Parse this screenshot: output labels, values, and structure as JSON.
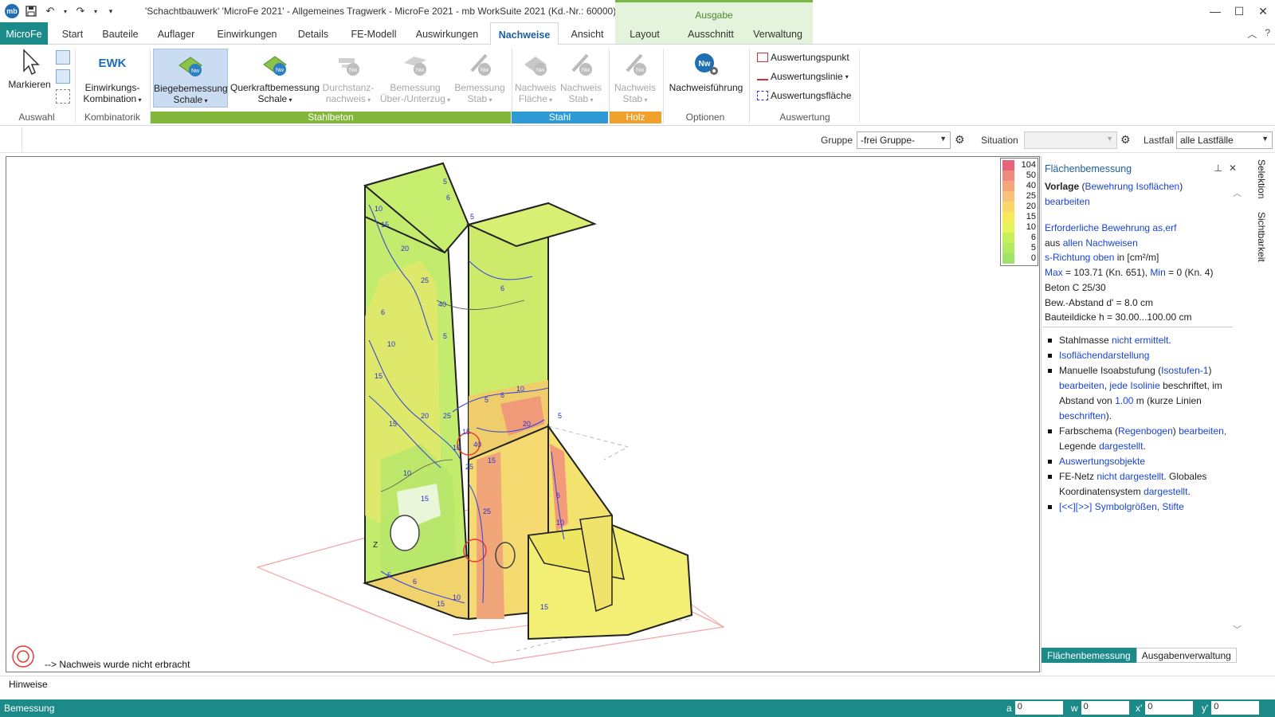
{
  "titlebar": {
    "title": "'Schachtbauwerk' 'MicroFe 2021' -  Allgemeines Tragwerk - MicroFe 2021 -  mb WorkSuite 2021 (Kd.-Nr.: 60000)",
    "context_group": "Ausgabe",
    "logo_text": "mb"
  },
  "tabs": {
    "file": "MicroFe",
    "items": [
      "Start",
      "Bauteile",
      "Auflager",
      "Einwirkungen",
      "Details",
      "FE-Modell",
      "Auswirkungen",
      "Nachweise",
      "Ansicht",
      "Layout",
      "Ausschnitt",
      "Verwaltung"
    ],
    "active": "Nachweise"
  },
  "ribbon": {
    "markieren": "Markieren",
    "ewk_icon": "EWK",
    "ewk_line1": "Einwirkungs-",
    "ewk_line2": "Kombination",
    "bieg_line1": "Biegebemessung",
    "bieg_line2": "Schale",
    "quer_line1": "Querkraftbemessung",
    "quer_line2": "Schale",
    "durch_line1": "Durchstanz-",
    "durch_line2": "nachweis",
    "bem_line1": "Bemessung",
    "bem_line2": "Über-/Unterzug",
    "bemstab_line1": "Bemessung",
    "bemstab_line2": "Stab",
    "nwfl_line1": "Nachweis",
    "nwfl_line2": "Fläche",
    "nwstab_line1": "Nachweis",
    "nwstab_line2": "Stab",
    "holzstab_line1": "Nachweis",
    "holzstab_line2": "Stab",
    "nwf": "Nachweisführung",
    "ausw_punkt": "Auswertungspunkt",
    "ausw_linie": "Auswertungslinie",
    "ausw_flaeche": "Auswertungsfläche",
    "groups": {
      "auswahl": "Auswahl",
      "kombinatorik": "Kombinatorik",
      "stahlbeton": "Stahlbeton",
      "stahl": "Stahl",
      "holz": "Holz",
      "optionen": "Optionen",
      "auswertung": "Auswertung"
    }
  },
  "filterbar": {
    "gruppe_label": "Gruppe",
    "gruppe_value": "-frei Gruppe-",
    "situation_label": "Situation",
    "situation_value": "",
    "lastfall_label": "Lastfall",
    "lastfall_value": "alle Lastfälle"
  },
  "legend": {
    "levels": [
      "104",
      "50",
      "40",
      "25",
      "20",
      "15",
      "10",
      "6",
      "5",
      "0"
    ],
    "colors": [
      "#e8647a",
      "#ef8a7e",
      "#f4a57c",
      "#f7c27a",
      "#f9d76a",
      "#f6ea5c",
      "#e6f35a",
      "#c8ef5a",
      "#b2ea60",
      "#9fe46a"
    ]
  },
  "viewport": {
    "hint": "--> Nachweis wurde nicht erbracht",
    "contour_labels": [
      "5",
      "6",
      "10",
      "15",
      "20",
      "25",
      "40",
      "5",
      "6",
      "10",
      "15",
      "15",
      "20",
      "25",
      "10",
      "6",
      "5",
      "15",
      "10",
      "20",
      "25",
      "15",
      "40",
      "5",
      "6",
      "15",
      "10",
      "25",
      "5",
      "6",
      "10",
      "15",
      "6",
      "5",
      "15",
      "10"
    ]
  },
  "panel": {
    "title": "Flächenbemessung",
    "vorlage": "Vorlage",
    "vorlage_link": "Bewehrung Isoflächen",
    "bearbeiten": "bearbeiten",
    "erf": "Erforderliche Bewehrung as,erf",
    "aus_pre": "aus ",
    "aus_link": "allen Nachweisen",
    "srichtung": "s-Richtung oben",
    "srichtung_unit": " in [cm²/m]",
    "max_label": "Max",
    "max_value": " = 103.71 (Kn. 651), ",
    "min_label": "Min",
    "min_value": " = 0 (Kn. 4)",
    "beton": "Beton C 25/30",
    "bewabstand": "Bew.-Abstand d' = 8.0 cm",
    "bauteildicke": "Bauteildicke h = 30.00...100.00 cm",
    "bullets": {
      "stahlmasse_pre": "Stahlmasse ",
      "stahlmasse_link": "nicht ermittelt",
      "iso": "Isoflächendarstellung",
      "isoabst_pre": "Manuelle Isoabstufung (",
      "isoabst_link": "Isostufen-1",
      "isoabst_l2a": "bearbeiten",
      "isoabst_l2b": "jede Isolinie",
      "isoabst_l2c": " beschriftet, im",
      "isoabst_l3a": "Abstand von ",
      "isoabst_l3b": "1.00",
      "isoabst_l3c": " m (kurze Linien",
      "isoabst_l4": "beschriften",
      "farb_pre": "Farbschema (",
      "farb_link": "Regenbogen",
      "farb_link2": "bearbeiten,",
      "farb_l2a": "Legende ",
      "farb_l2b": "dargestellt",
      "auswobj": "Auswertungsobjekte",
      "fenetz_pre": "FE-Netz ",
      "fenetz_link": "nicht dargestellt",
      "fenetz_post": ". Globales",
      "koord_pre": "Koordinatensystem ",
      "koord_link": "dargestellt",
      "symbol": "[<<][>>] Symbolgrößen, Stifte"
    },
    "tabs": [
      "Flächenbemessung",
      "Ausgabenverwaltung"
    ]
  },
  "vtabs": [
    "Selektion",
    "Sichtbarkeit"
  ],
  "hinweise": "Hinweise",
  "statusbar": {
    "text": "Bemessung",
    "a_label": "a",
    "a_value": "0",
    "w_label": "w",
    "w_value": "0",
    "x_label": "x'",
    "x_value": "0",
    "y_label": "y'",
    "y_value": "0"
  }
}
